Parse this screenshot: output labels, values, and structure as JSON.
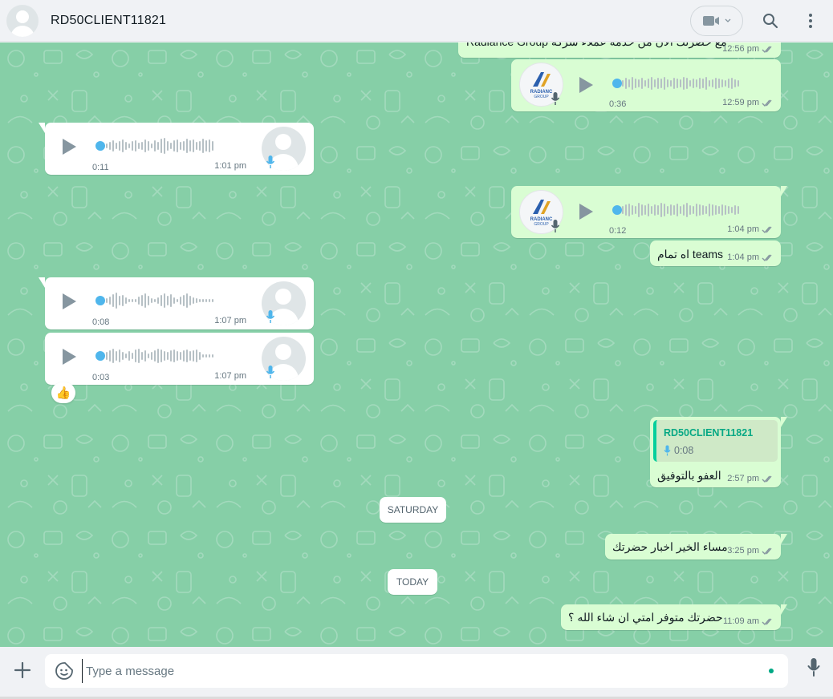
{
  "header": {
    "contact_name": "RD50CLIENT11821"
  },
  "messages": {
    "m1": {
      "text": "مع حضرتك الآن من خدمة عملاء شركة Radiance Group",
      "time": "12:56 pm"
    },
    "m2": {
      "duration": "0:36",
      "time": "12:59 pm",
      "logo_line1": "RADIANC",
      "logo_line2": "GROUP"
    },
    "m3": {
      "duration": "0:11",
      "time": "1:01 pm"
    },
    "m4": {
      "duration": "0:12",
      "time": "1:04 pm",
      "logo_line1": "RADIANC",
      "logo_line2": "GROUP"
    },
    "m5": {
      "text": "اه تمام teams",
      "time": "1:04 pm"
    },
    "m6": {
      "duration": "0:08",
      "time": "1:07 pm"
    },
    "m7": {
      "duration": "0:03",
      "time": "1:07 pm",
      "reaction": "👍"
    },
    "m8": {
      "quote_name": "RD50CLIENT11821",
      "quote_duration": "0:08",
      "text": "العفو بالتوفيق",
      "time": "2:57 pm"
    },
    "m9": {
      "text": "مساء الخير اخبار حضرتك",
      "time": "3:25 pm"
    },
    "m10": {
      "text": "حضرتك متوفر امتي ان شاء الله ؟",
      "time": "11:09 am"
    }
  },
  "dates": {
    "saturday": "SATURDAY",
    "today": "TODAY"
  },
  "composer": {
    "placeholder": "Type a message"
  },
  "colors": {
    "chat_bg": "#86cfa7",
    "outgoing": "#d9fdd3",
    "incoming": "#ffffff",
    "accent": "#00a884",
    "voice_dot": "#4fb6ec"
  }
}
